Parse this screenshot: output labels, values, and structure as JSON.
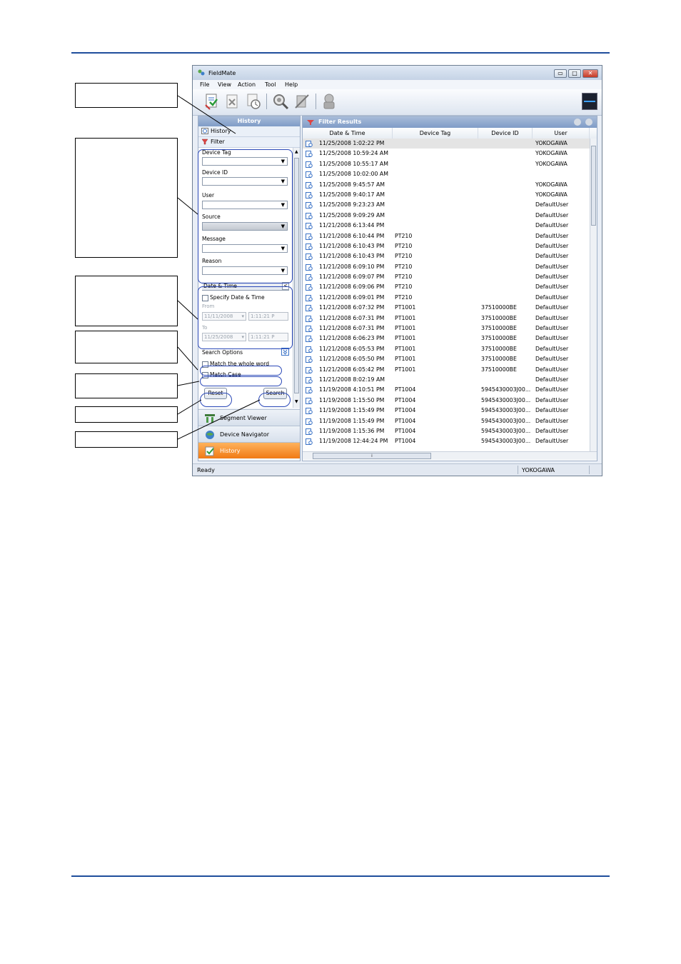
{
  "window": {
    "title": "FieldMate",
    "min_label": "▭",
    "max_label": "□",
    "close_label": "✕"
  },
  "menu": [
    "File",
    "View",
    "Action",
    "Tool",
    "Help"
  ],
  "left_pane": {
    "header": "History",
    "tab_history": "History",
    "tab_filter": "Filter",
    "filters": {
      "device_tag_label": "Device Tag",
      "device_id_label": "Device ID",
      "user_label": "User",
      "source_label": "Source",
      "message_label": "Message",
      "reason_label": "Reason"
    },
    "date_time": {
      "section_title": "Date & Time",
      "collapse": "<",
      "specify_label": "Specify Date & Time",
      "from_label": "From",
      "from_date": "11/11/2008",
      "from_time": "1:11:21 P",
      "to_label": "To",
      "to_date": "11/25/2008",
      "to_time": "1:11:21 P"
    },
    "search_options": {
      "title": "Search Options",
      "match_whole_word": "Match the whole word",
      "match_case": "Match Case"
    },
    "reset_button": "Reset",
    "search_button": "Search",
    "nav": {
      "segment_viewer": "Segment Viewer",
      "device_navigator": "Device Navigator",
      "history": "History"
    }
  },
  "results": {
    "header": "Filter Results",
    "columns": [
      "Date & Time",
      "Device Tag",
      "Device ID",
      "User"
    ],
    "rows": [
      {
        "dt": "11/25/2008 1:02:22 PM",
        "tag": "",
        "id": "",
        "user": "YOKOGAWA"
      },
      {
        "dt": "11/25/2008 10:59:24 AM",
        "tag": "",
        "id": "",
        "user": "YOKOGAWA"
      },
      {
        "dt": "11/25/2008 10:55:17 AM",
        "tag": "",
        "id": "",
        "user": "YOKOGAWA"
      },
      {
        "dt": "11/25/2008 10:02:00 AM",
        "tag": "",
        "id": "",
        "user": ""
      },
      {
        "dt": "11/25/2008 9:45:57 AM",
        "tag": "",
        "id": "",
        "user": "YOKOGAWA"
      },
      {
        "dt": "11/25/2008 9:40:17 AM",
        "tag": "",
        "id": "",
        "user": "YOKOGAWA"
      },
      {
        "dt": "11/25/2008 9:23:23 AM",
        "tag": "",
        "id": "",
        "user": "DefaultUser"
      },
      {
        "dt": "11/25/2008 9:09:29 AM",
        "tag": "",
        "id": "",
        "user": "DefaultUser"
      },
      {
        "dt": "11/21/2008 6:13:44 PM",
        "tag": "",
        "id": "",
        "user": "DefaultUser"
      },
      {
        "dt": "11/21/2008 6:10:44 PM",
        "tag": "PT210",
        "id": "",
        "user": "DefaultUser"
      },
      {
        "dt": "11/21/2008 6:10:43 PM",
        "tag": "PT210",
        "id": "",
        "user": "DefaultUser"
      },
      {
        "dt": "11/21/2008 6:10:43 PM",
        "tag": "PT210",
        "id": "",
        "user": "DefaultUser"
      },
      {
        "dt": "11/21/2008 6:09:10 PM",
        "tag": "PT210",
        "id": "",
        "user": "DefaultUser"
      },
      {
        "dt": "11/21/2008 6:09:07 PM",
        "tag": "PT210",
        "id": "",
        "user": "DefaultUser"
      },
      {
        "dt": "11/21/2008 6:09:06 PM",
        "tag": "PT210",
        "id": "",
        "user": "DefaultUser"
      },
      {
        "dt": "11/21/2008 6:09:01 PM",
        "tag": "PT210",
        "id": "",
        "user": "DefaultUser"
      },
      {
        "dt": "11/21/2008 6:07:32 PM",
        "tag": "PT1001",
        "id": "37510000BE",
        "user": "DefaultUser"
      },
      {
        "dt": "11/21/2008 6:07:31 PM",
        "tag": "PT1001",
        "id": "37510000BE",
        "user": "DefaultUser"
      },
      {
        "dt": "11/21/2008 6:07:31 PM",
        "tag": "PT1001",
        "id": "37510000BE",
        "user": "DefaultUser"
      },
      {
        "dt": "11/21/2008 6:06:23 PM",
        "tag": "PT1001",
        "id": "37510000BE",
        "user": "DefaultUser"
      },
      {
        "dt": "11/21/2008 6:05:53 PM",
        "tag": "PT1001",
        "id": "37510000BE",
        "user": "DefaultUser"
      },
      {
        "dt": "11/21/2008 6:05:50 PM",
        "tag": "PT1001",
        "id": "37510000BE",
        "user": "DefaultUser"
      },
      {
        "dt": "11/21/2008 6:05:42 PM",
        "tag": "PT1001",
        "id": "37510000BE",
        "user": "DefaultUser"
      },
      {
        "dt": "11/21/2008 8:02:19 AM",
        "tag": "",
        "id": "",
        "user": "DefaultUser"
      },
      {
        "dt": "11/19/2008 4:10:51 PM",
        "tag": "PT1004",
        "id": "5945430003J00...",
        "user": "DefaultUser"
      },
      {
        "dt": "11/19/2008 1:15:50 PM",
        "tag": "PT1004",
        "id": "5945430003J00...",
        "user": "DefaultUser"
      },
      {
        "dt": "11/19/2008 1:15:49 PM",
        "tag": "PT1004",
        "id": "5945430003J00...",
        "user": "DefaultUser"
      },
      {
        "dt": "11/19/2008 1:15:49 PM",
        "tag": "PT1004",
        "id": "5945430003J00...",
        "user": "DefaultUser"
      },
      {
        "dt": "11/19/2008 1:15:36 PM",
        "tag": "PT1004",
        "id": "5945430003J00...",
        "user": "DefaultUser"
      },
      {
        "dt": "11/19/2008 12:44:24 PM",
        "tag": "PT1004",
        "id": "5945430003J00...",
        "user": "DefaultUser"
      }
    ]
  },
  "status": {
    "left": "Ready",
    "right": "YOKOGAWA"
  },
  "colors": {
    "accent_rule": "#1f4e9c",
    "callout_oval": "#2b49b8",
    "active_nav": "#f07a14"
  }
}
